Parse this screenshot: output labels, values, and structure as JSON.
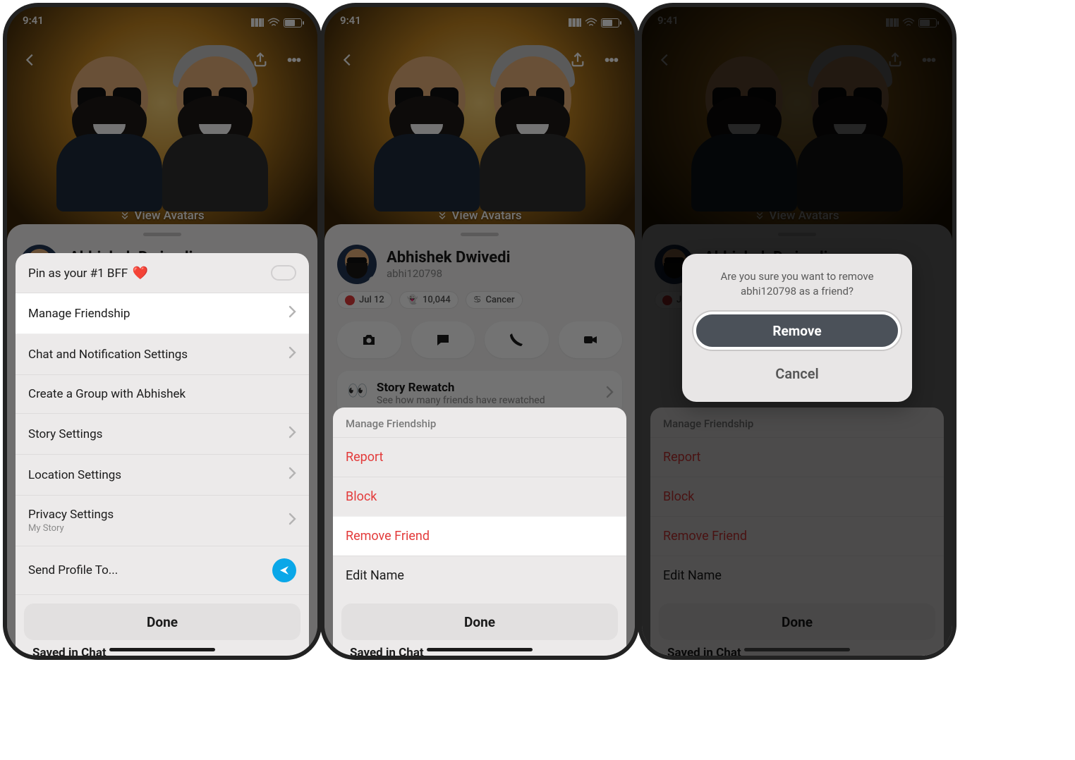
{
  "statusbar": {
    "time": "9:41"
  },
  "topbar": {
    "view_avatars": "View Avatars"
  },
  "profile": {
    "name": "Abhishek Dwivedi",
    "handle": "abhi120798",
    "badge_date": "Jul 12",
    "badge_score": "10,044",
    "badge_zodiac": "Cancer"
  },
  "story_card": {
    "title": "Story Rewatch",
    "subtitle": "See how many friends have rewatched"
  },
  "settings_sheet": {
    "pin_bff": "Pin as your #1 BFF",
    "manage": "Manage Friendship",
    "chat_notif": "Chat and Notification Settings",
    "create_group": "Create a Group with Abhishek",
    "story_settings": "Story Settings",
    "location_settings": "Location Settings",
    "privacy_settings": "Privacy Settings",
    "privacy_sub": "My Story",
    "send_profile": "Send Profile To...",
    "done": "Done",
    "saved": "Saved in Chat"
  },
  "manage_sheet": {
    "header": "Manage Friendship",
    "report": "Report",
    "block": "Block",
    "remove_friend": "Remove Friend",
    "edit_name": "Edit Name",
    "done": "Done",
    "saved": "Saved in Chat"
  },
  "alert": {
    "message": "Are you sure you want to remove abhi120798 as a friend?",
    "remove": "Remove",
    "cancel": "Cancel"
  }
}
